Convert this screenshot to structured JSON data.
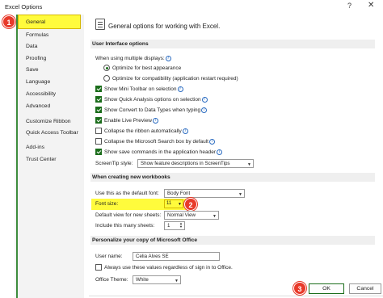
{
  "window": {
    "title": "Excel Options",
    "help": "?",
    "close": "✕"
  },
  "sidebar": {
    "items": [
      {
        "label": "General",
        "selected": true
      },
      {
        "label": "Formulas"
      },
      {
        "label": "Data"
      },
      {
        "label": "Proofing"
      },
      {
        "label": "Save"
      },
      {
        "label": "Language"
      },
      {
        "label": "Accessibility"
      },
      {
        "label": "Advanced"
      },
      {
        "label": "Customize Ribbon"
      },
      {
        "label": "Quick Access Toolbar"
      },
      {
        "label": "Add-ins"
      },
      {
        "label": "Trust Center"
      }
    ]
  },
  "callouts": {
    "one": "1",
    "two": "2",
    "three": "3"
  },
  "header": {
    "text": "General options for working with Excel.",
    "icon": "general-options-icon"
  },
  "ui_options": {
    "section": "User Interface options",
    "multiple_displays": "When using multiple displays:",
    "optimize_appearance": "Optimize for best appearance",
    "optimize_compat": "Optimize for compatibility (application restart required)",
    "mini_toolbar": "Show Mini Toolbar on selection",
    "quick_analysis": "Show Quick Analysis options on selection",
    "convert_types": "Show Convert to Data Types when typing",
    "live_preview": "Enable Live Preview",
    "collapse_ribbon": "Collapse the ribbon automatically",
    "collapse_search": "Collapse the Microsoft Search box by default",
    "save_commands": "Show save commands in the application header",
    "screentip_label": "ScreenTip style:",
    "screentip_value": "Show feature descriptions in ScreenTips"
  },
  "new_workbooks": {
    "section": "When creating new workbooks",
    "font_label": "Use this as the default font:",
    "font_value": "Body Font",
    "size_label": "Font size:",
    "size_value": "11",
    "view_label": "Default view for new sheets:",
    "view_value": "Normal View",
    "sheets_label": "Include this many sheets:",
    "sheets_value": "1"
  },
  "personalize": {
    "section": "Personalize your copy of Microsoft Office",
    "username_label": "User name:",
    "username_value": "Celia Alves SE",
    "always_use": "Always use these values regardless of sign in to Office.",
    "theme_label": "Office Theme:",
    "theme_value": "White"
  },
  "footer": {
    "ok": "OK",
    "cancel": "Cancel"
  }
}
